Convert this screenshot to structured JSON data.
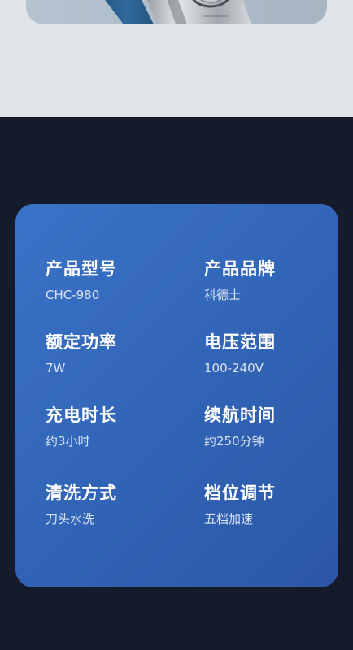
{
  "specs": [
    {
      "label": "产品型号",
      "value": "CHC-980"
    },
    {
      "label": "产品品牌",
      "value": "科德士"
    },
    {
      "label": "额定功率",
      "value": "7W"
    },
    {
      "label": "电压范围",
      "value": "100-240V"
    },
    {
      "label": "充电时长",
      "value": "约3小时"
    },
    {
      "label": "续航时间",
      "value": "约250分钟"
    },
    {
      "label": "清洗方式",
      "value": "刀头水洗"
    },
    {
      "label": "档位调节",
      "value": "五档加速"
    }
  ]
}
